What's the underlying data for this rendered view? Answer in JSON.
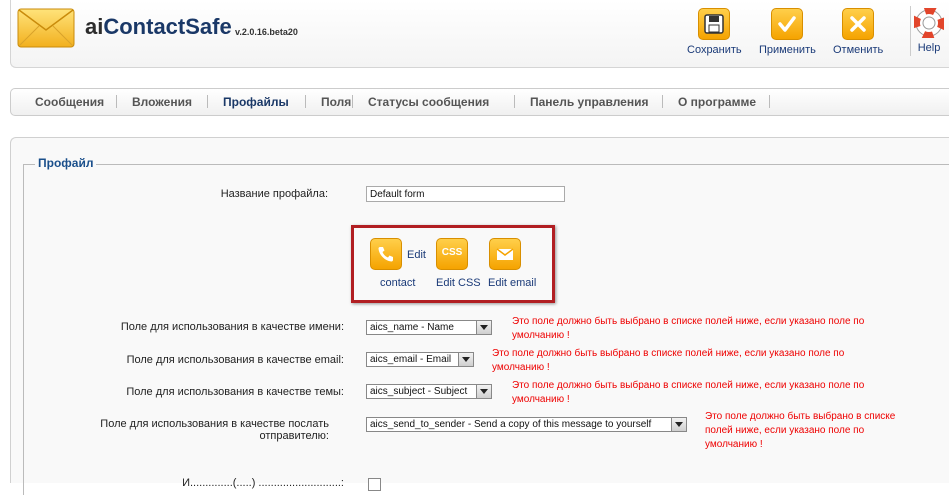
{
  "header": {
    "app_name_prefix": "ai",
    "app_name_rest": "ContactSafe",
    "version": "v.2.0.16.beta20",
    "toolbar": {
      "save": "Сохранить",
      "apply": "Применить",
      "cancel": "Отменить",
      "help": "Help"
    }
  },
  "tabs": [
    "Сообщения",
    "Вложения",
    "Профайлы",
    "Поля",
    "Статусы сообщения",
    "Панель управления",
    "О программе"
  ],
  "active_tab": "Профайлы",
  "profile": {
    "legend": "Профайл",
    "name_label": "Название профайла:",
    "name_value": "Default form",
    "actions": {
      "edit_contact_top": "Edit",
      "edit_contact_bottom": "contact",
      "css_icon_text": "CSS",
      "edit_css": "Edit CSS",
      "edit_email": "Edit email"
    },
    "fields": [
      {
        "label": "Поле для использования в качестве имени:",
        "value": "aics_name - Name",
        "warning_1": "Это поле должно быть выбрано в списке полей ниже, если указано поле по",
        "warning_2": "умолчанию !"
      },
      {
        "label": "Поле для использования в качестве email:",
        "value": "aics_email - Email",
        "warning_1": "Это поле должно быть выбрано в списке полей ниже, если указано поле по",
        "warning_2": "умолчанию !"
      },
      {
        "label": "Поле для использования в качестве темы:",
        "value": "aics_subject - Subject",
        "warning_1": "Это поле должно быть выбрано в списке полей ниже, если указано поле по",
        "warning_2": "умолчанию !"
      },
      {
        "label_1": "Поле для использования в качестве послать",
        "label_2": "отправителю:",
        "value": "aics_send_to_sender - Send a copy of this message to yourself",
        "warning_1": "Это поле должно быть выбрано в списке",
        "warning_2": "полей ниже, если указано поле по",
        "warning_3": "умолчанию !"
      }
    ],
    "partial_label": "И..............(.....) ...........................:"
  },
  "colors": {
    "accent_orange": "#f5a300",
    "link_blue": "#1a3a78",
    "warning_red": "#e00000",
    "highlight_red": "#b11e22"
  }
}
